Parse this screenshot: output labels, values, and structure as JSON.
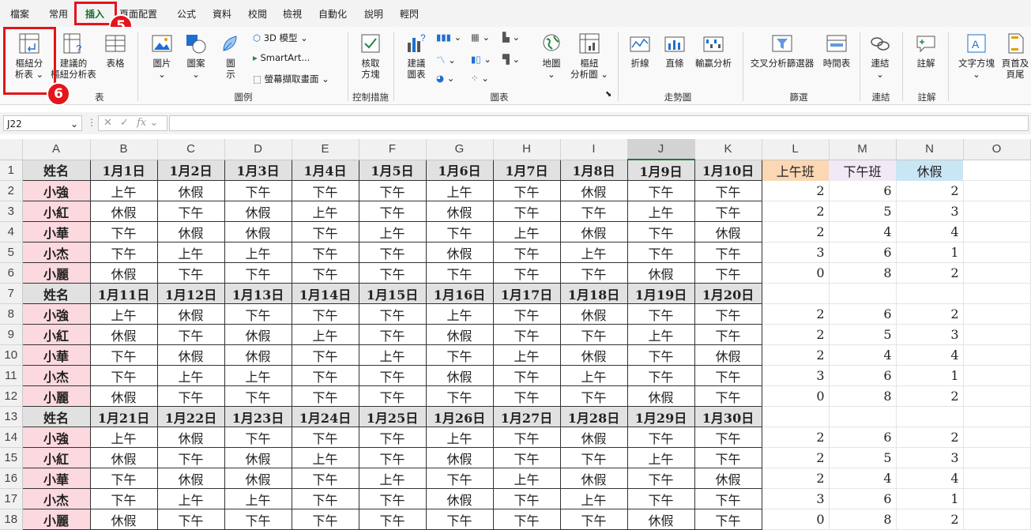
{
  "menu_tabs": [
    "檔案",
    "常用",
    "插入",
    "頁面配置",
    "公式",
    "資料",
    "校閱",
    "檢視",
    "自動化",
    "說明",
    "輕閃"
  ],
  "active_tab": "插入",
  "ribbon": {
    "pivot_table": [
      "樞紐分",
      "析表"
    ],
    "recommended_pivot": [
      "建議的",
      "樞紐分析表"
    ],
    "table": "表格",
    "picture": "圖片",
    "shapes": "圖案",
    "icons": [
      "圖",
      "示"
    ],
    "model3d": "3D 模型",
    "smartart": "SmartArt...",
    "screenshot": "螢幕擷取畫面",
    "checkbox": [
      "核取",
      "方塊"
    ],
    "recommended_charts": [
      "建議",
      "圖表"
    ],
    "maps": "地圖",
    "pivot_chart": [
      "樞紐",
      "分析圖"
    ],
    "spark_line": "折線",
    "spark_column": "直條",
    "spark_winloss": "輸贏分析",
    "slicer": "交叉分析篩選器",
    "timeline": "時間表",
    "link": "連結",
    "comment": "註解",
    "textbox": "文字方塊",
    "header_footer": [
      "頁首及",
      "頁尾"
    ],
    "groups": {
      "illustrations": "圖例",
      "controls": "控制措施",
      "charts": "圖表",
      "sparklines": "走勢圖",
      "filters": "篩選",
      "links": "連結",
      "comments": "註解",
      "tables_partial": "表"
    }
  },
  "badges": {
    "insert_tab": "5",
    "pivot_table": "6"
  },
  "name_box": "J22",
  "fx_symbol": "fx",
  "columns": [
    "A",
    "B",
    "C",
    "D",
    "E",
    "F",
    "G",
    "H",
    "I",
    "J",
    "K",
    "L",
    "M",
    "N",
    "O"
  ],
  "selected_column": "J",
  "summary_headers": [
    "上午班",
    "下午班",
    "休假"
  ],
  "rows": [
    {
      "n": "1",
      "type": "hdr",
      "cells": [
        "姓名",
        "1月1日",
        "1月2日",
        "1月3日",
        "1月4日",
        "1月5日",
        "1月6日",
        "1月7日",
        "1月8日",
        "1月9日",
        "1月10日"
      ],
      "summary": "headers"
    },
    {
      "n": "2",
      "type": "data",
      "cells": [
        "小強",
        "上午",
        "休假",
        "下午",
        "下午",
        "下午",
        "上午",
        "下午",
        "休假",
        "下午",
        "下午"
      ],
      "summary": [
        "2",
        "6",
        "2"
      ]
    },
    {
      "n": "3",
      "type": "data",
      "cells": [
        "小紅",
        "休假",
        "下午",
        "休假",
        "上午",
        "下午",
        "休假",
        "下午",
        "下午",
        "上午",
        "下午"
      ],
      "summary": [
        "2",
        "5",
        "3"
      ]
    },
    {
      "n": "4",
      "type": "data",
      "cells": [
        "小華",
        "下午",
        "休假",
        "休假",
        "下午",
        "上午",
        "下午",
        "上午",
        "休假",
        "下午",
        "休假"
      ],
      "summary": [
        "2",
        "4",
        "4"
      ]
    },
    {
      "n": "5",
      "type": "data",
      "cells": [
        "小杰",
        "下午",
        "上午",
        "上午",
        "下午",
        "下午",
        "休假",
        "下午",
        "上午",
        "下午",
        "下午"
      ],
      "summary": [
        "3",
        "6",
        "1"
      ]
    },
    {
      "n": "6",
      "type": "data",
      "cells": [
        "小麗",
        "休假",
        "下午",
        "下午",
        "下午",
        "下午",
        "下午",
        "下午",
        "下午",
        "休假",
        "下午"
      ],
      "summary": [
        "0",
        "8",
        "2"
      ]
    },
    {
      "n": "7",
      "type": "hdr",
      "cells": [
        "姓名",
        "1月11日",
        "1月12日",
        "1月13日",
        "1月14日",
        "1月15日",
        "1月16日",
        "1月17日",
        "1月18日",
        "1月19日",
        "1月20日"
      ],
      "summary": [
        "",
        "",
        ""
      ]
    },
    {
      "n": "8",
      "type": "data",
      "cells": [
        "小強",
        "上午",
        "休假",
        "下午",
        "下午",
        "下午",
        "上午",
        "下午",
        "休假",
        "下午",
        "下午"
      ],
      "summary": [
        "2",
        "6",
        "2"
      ]
    },
    {
      "n": "9",
      "type": "data",
      "cells": [
        "小紅",
        "休假",
        "下午",
        "休假",
        "上午",
        "下午",
        "休假",
        "下午",
        "下午",
        "上午",
        "下午"
      ],
      "summary": [
        "2",
        "5",
        "3"
      ]
    },
    {
      "n": "10",
      "type": "data",
      "cells": [
        "小華",
        "下午",
        "休假",
        "休假",
        "下午",
        "上午",
        "下午",
        "上午",
        "休假",
        "下午",
        "休假"
      ],
      "summary": [
        "2",
        "4",
        "4"
      ]
    },
    {
      "n": "11",
      "type": "data",
      "cells": [
        "小杰",
        "下午",
        "上午",
        "上午",
        "下午",
        "下午",
        "休假",
        "下午",
        "上午",
        "下午",
        "下午"
      ],
      "summary": [
        "3",
        "6",
        "1"
      ]
    },
    {
      "n": "12",
      "type": "data",
      "cells": [
        "小麗",
        "休假",
        "下午",
        "下午",
        "下午",
        "下午",
        "下午",
        "下午",
        "下午",
        "休假",
        "下午"
      ],
      "summary": [
        "0",
        "8",
        "2"
      ]
    },
    {
      "n": "13",
      "type": "hdr",
      "cells": [
        "姓名",
        "1月21日",
        "1月22日",
        "1月23日",
        "1月24日",
        "1月25日",
        "1月26日",
        "1月27日",
        "1月28日",
        "1月29日",
        "1月30日"
      ],
      "summary": [
        "",
        "",
        ""
      ]
    },
    {
      "n": "14",
      "type": "data",
      "cells": [
        "小強",
        "上午",
        "休假",
        "下午",
        "下午",
        "下午",
        "上午",
        "下午",
        "休假",
        "下午",
        "下午"
      ],
      "summary": [
        "2",
        "6",
        "2"
      ]
    },
    {
      "n": "15",
      "type": "data",
      "cells": [
        "小紅",
        "休假",
        "下午",
        "休假",
        "上午",
        "下午",
        "休假",
        "下午",
        "下午",
        "上午",
        "下午"
      ],
      "summary": [
        "2",
        "5",
        "3"
      ]
    },
    {
      "n": "16",
      "type": "data",
      "cells": [
        "小華",
        "下午",
        "休假",
        "休假",
        "下午",
        "上午",
        "下午",
        "上午",
        "休假",
        "下午",
        "休假"
      ],
      "summary": [
        "2",
        "4",
        "4"
      ]
    },
    {
      "n": "17",
      "type": "data",
      "cells": [
        "小杰",
        "下午",
        "上午",
        "上午",
        "下午",
        "下午",
        "休假",
        "下午",
        "上午",
        "下午",
        "下午"
      ],
      "summary": [
        "3",
        "6",
        "1"
      ]
    },
    {
      "n": "18",
      "type": "data",
      "cells": [
        "小麗",
        "休假",
        "下午",
        "下午",
        "下午",
        "下午",
        "下午",
        "下午",
        "下午",
        "休假",
        "下午"
      ],
      "summary": [
        "0",
        "8",
        "2"
      ]
    }
  ]
}
